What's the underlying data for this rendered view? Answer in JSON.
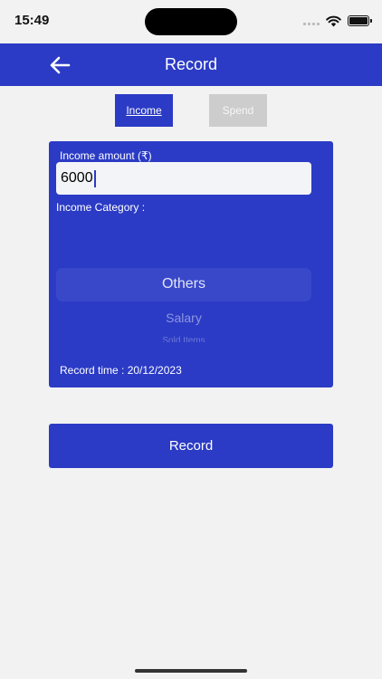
{
  "status": {
    "time": "15:49"
  },
  "header": {
    "title": "Record"
  },
  "tabs": {
    "income_label": "Income",
    "spend_label": "Spend",
    "active": "Income"
  },
  "form": {
    "amount_label": "Income amount (₹)",
    "amount_value": "6000",
    "category_label": "Income Category :",
    "category_options": [
      "Others",
      "Salary",
      "Sold Items"
    ],
    "selected_category": "Others",
    "record_time": "Record time : 20/12/2023"
  },
  "actions": {
    "record_label": "Record"
  },
  "colors": {
    "primary": "#2b3bc5",
    "background": "#f2f2f2",
    "inactive_tab": "#cdcdcd"
  },
  "icons": {
    "back": "arrow-left-icon",
    "wifi": "wifi-icon",
    "battery": "battery-icon",
    "signal": "signal-icon"
  }
}
